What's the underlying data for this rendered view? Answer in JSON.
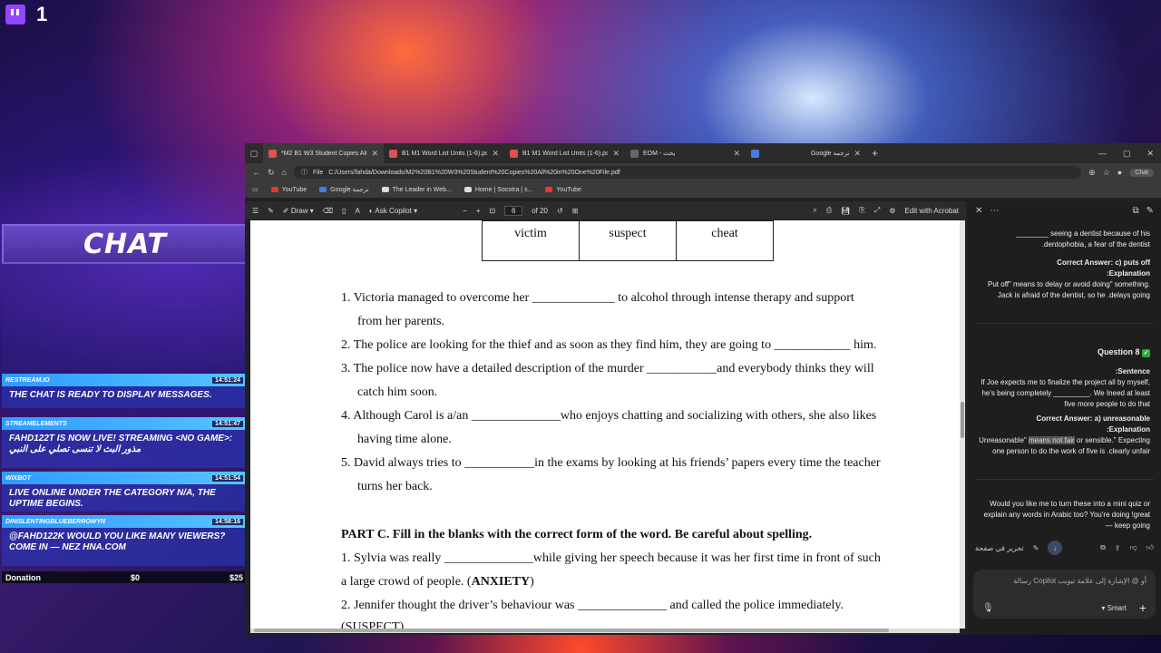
{
  "overlay": {
    "counter": "1",
    "chat_title": "CHAT",
    "messages": [
      {
        "user": "RESTREAM.IO",
        "time": "14:51:24",
        "text": "THE CHAT IS READY TO DISPLAY MESSAGES."
      },
      {
        "user": "STREAMELEMENTS",
        "time": "14:51:47",
        "text": "FAHD122T IS NOW LIVE! STREAMING <NO GAME>: مذور البث لا تنسى تصلي على النبي"
      },
      {
        "user": "WIXBOT",
        "time": "14:51:54",
        "text": "LIVE ONLINE UNDER THE CATEGORY N/A, THE UPTIME BEGINS."
      },
      {
        "user": "DINISLENTINGBLUEBERROWYN",
        "time": "14:58:16",
        "text": "@FAHD122K WOULD YOU LIKE MANY VIEWERS? COME IN — NEZ HNA.COM"
      }
    ],
    "donation": {
      "label": "Donation",
      "current": "$0",
      "goal": "$25"
    }
  },
  "browser": {
    "tabs": [
      {
        "title": "*M2 B1 W3 Student Copies All in",
        "active": true,
        "color": "#e05050"
      },
      {
        "title": "B1 M1 Word List Units (1-6).pdf",
        "active": false,
        "color": "#e05050"
      },
      {
        "title": "B1 M1 Word List Units (1-6).pdf",
        "active": false,
        "color": "#e05050"
      },
      {
        "title": "EOM - بحث",
        "active": false,
        "color": "#666"
      },
      {
        "title": "Google ترجمة",
        "active": false,
        "color": "#4a7be0"
      }
    ],
    "address": "C:/Users/fahda/Downloads/M2%20B1%20W3%20Student%20Copies%20All%20in%20One%20File.pdf",
    "address_prefix": "File",
    "chat_button": "Chat",
    "bookmarks": [
      "YouTube",
      "Google ترجمة",
      "The Leader in Web...",
      "Home | Socotra | s...",
      "YouTube"
    ]
  },
  "pdf_toolbar": {
    "draw": "Draw",
    "ask_copilot": "Ask Copilot",
    "page": "6",
    "of_pages": "of 20",
    "edit_with_acrobat": "Edit with Acrobat"
  },
  "document": {
    "table_words": [
      "victim",
      "suspect",
      "cheat"
    ],
    "lines": [
      "1. Victoria managed to overcome her _____________ to alcohol through intense therapy and support",
      "from her parents.",
      "2. The police are looking for the thief and as soon as they find him, they are going to ____________ him.",
      "3. The police now have a detailed description of the murder ___________and everybody thinks they will",
      "catch him soon.",
      "4. Although Carol is a/an ______________who enjoys chatting and socializing with others, she also likes",
      "having time alone.",
      "5. David always tries to ___________in the exams by looking at his friends’ papers every time the teacher",
      "turns her back."
    ],
    "part_c": "PART C. Fill in the blanks with the correct form of the word. Be careful about spelling.",
    "c1a": "1. Sylvia was really ______________while giving her speech because it was her first time in front of such",
    "c1b_pre": "a large crowd of people. (",
    "c1b_word": "ANXIETY",
    "c1b_post": ")",
    "c2": "2. Jennifer thought the driver’s behaviour was ______________ and called the police immediately.",
    "c2b": "(SUSPECT)"
  },
  "copilot": {
    "p1": "________ seeing a dentist because of his .dentophobia, a fear of the dentist",
    "answer7": "Correct Answer: c) puts off",
    "expl_label": ":Explanation",
    "expl7": "Put off\" means to delay or avoid doing\" something. Jack is afraid of the dentist, so he .delays going",
    "q8": "Question 8",
    "sentence_label": ":Sentence",
    "q8_text": "If Joe expects me to finalize the project all by myself, he's being completely _________. We Ineed at least five more people to do that",
    "answer8": "Correct Answer: a) unreasonable",
    "expl8_pre": "Unreasonable\" ",
    "expl8_hl": "means not fair",
    "expl8_post": " or sensible.\" Expecting one person to do the work of five is .clearly unfair",
    "followup": "Would you like me to turn these into a mini quiz or explain any words in Arabic too? You're doing !great — keep going",
    "edit_on_page": "تحرير في صفحة",
    "input_placeholder": "رسالة Copilot أو @ الإشارة إلى علامة تبويب",
    "smart": "Smart"
  }
}
